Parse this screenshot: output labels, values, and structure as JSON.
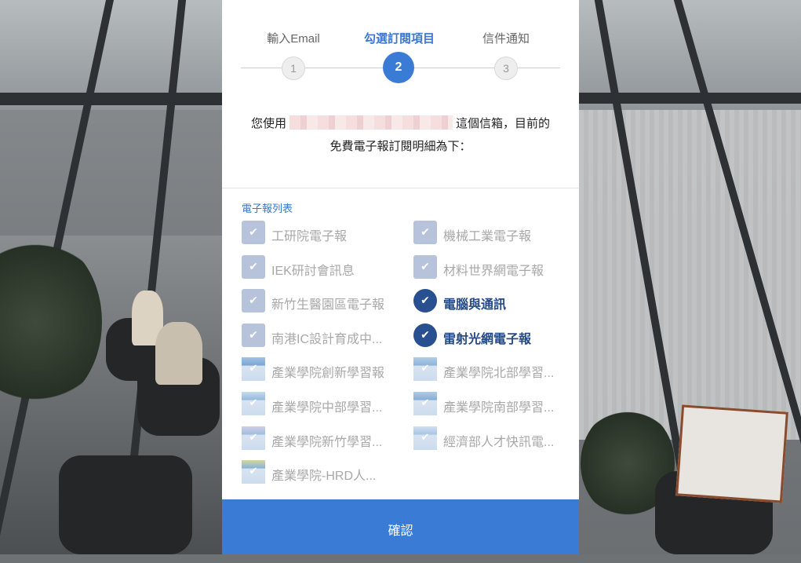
{
  "steps": [
    {
      "label": "輸入Email",
      "number": "1",
      "active": false
    },
    {
      "label": "勾選訂閱項目",
      "number": "2",
      "active": true
    },
    {
      "label": "信件通知",
      "number": "3",
      "active": false
    }
  ],
  "intro": {
    "line1_prefix": "您使用",
    "line1_suffix": "這個信箱，目前的",
    "line2": "免費電子報訂閱明細為下："
  },
  "list_title": "電子報列表",
  "items": [
    {
      "label": "工研院電子報",
      "checked": false,
      "style": "box"
    },
    {
      "label": "機械工業電子報",
      "checked": false,
      "style": "box"
    },
    {
      "label": "IEK研討會訊息",
      "checked": false,
      "style": "box"
    },
    {
      "label": "材料世界網電子報",
      "checked": false,
      "style": "box"
    },
    {
      "label": "新竹生醫園區電子報",
      "checked": false,
      "style": "box"
    },
    {
      "label": "電腦與通訊",
      "checked": true,
      "style": "circle"
    },
    {
      "label": "南港IC設計育成中...",
      "checked": false,
      "style": "box"
    },
    {
      "label": "雷射光網電子報",
      "checked": true,
      "style": "circle"
    },
    {
      "label": "產業學院創新學習報",
      "checked": false,
      "style": "thumb"
    },
    {
      "label": "產業學院北部學習...",
      "checked": false,
      "style": "thumb"
    },
    {
      "label": "產業學院中部學習...",
      "checked": false,
      "style": "thumb"
    },
    {
      "label": "產業學院南部學習...",
      "checked": false,
      "style": "thumb"
    },
    {
      "label": "產業學院新竹學習...",
      "checked": false,
      "style": "thumb"
    },
    {
      "label": "經濟部人才快訊電...",
      "checked": false,
      "style": "thumb"
    },
    {
      "label": "產業學院-HRD人...",
      "checked": false,
      "style": "thumb"
    }
  ],
  "confirm_label": "確認",
  "colors": {
    "accent": "#3a7bd5",
    "checked": "#284f8f",
    "unchecked": "#b6c3da"
  }
}
